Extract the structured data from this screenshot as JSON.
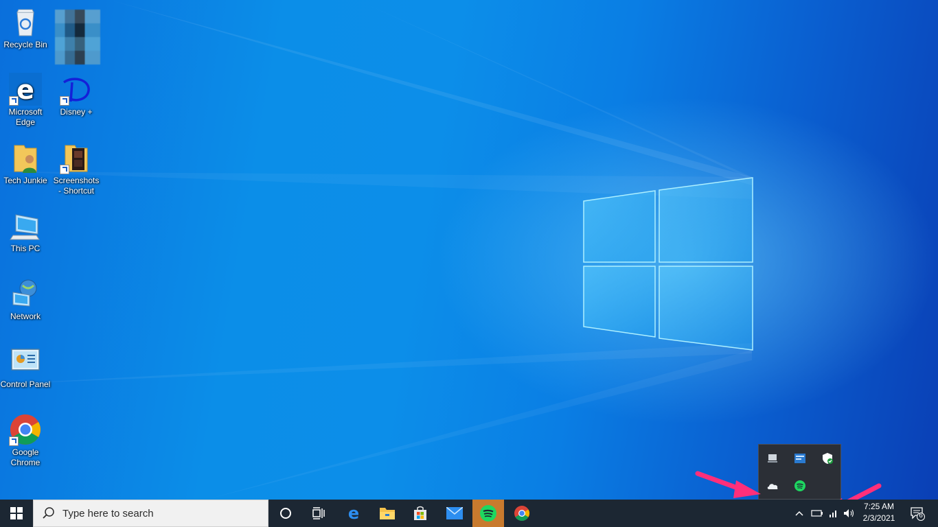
{
  "desktop": {
    "icons": [
      {
        "label": "Recycle Bin"
      },
      {
        "label": "Microsoft Edge"
      },
      {
        "label": "Disney +"
      },
      {
        "label": "Tech Junkie"
      },
      {
        "label": "Screenshots - Shortcut"
      },
      {
        "label": "This PC"
      },
      {
        "label": "Network"
      },
      {
        "label": "Control Panel"
      },
      {
        "label": "Google Chrome"
      }
    ]
  },
  "tray_flyout": {
    "icons": [
      "display-icon",
      "network-adapter-icon",
      "windows-security-icon",
      "onedrive-icon",
      "spotify-icon"
    ]
  },
  "taskbar": {
    "search_placeholder": "Type here to search",
    "apps": [
      "cortana-icon",
      "task-view-icon",
      "edge-icon",
      "file-explorer-icon",
      "store-icon",
      "mail-icon",
      "spotify-icon",
      "chrome-icon"
    ],
    "time": "7:25 AM",
    "date": "2/3/2021",
    "notification_count": "6"
  },
  "colors": {
    "taskbar": "#1c2733",
    "spotify_active": "#c87a2e",
    "annotation_arrow": "#ff2f7a"
  }
}
